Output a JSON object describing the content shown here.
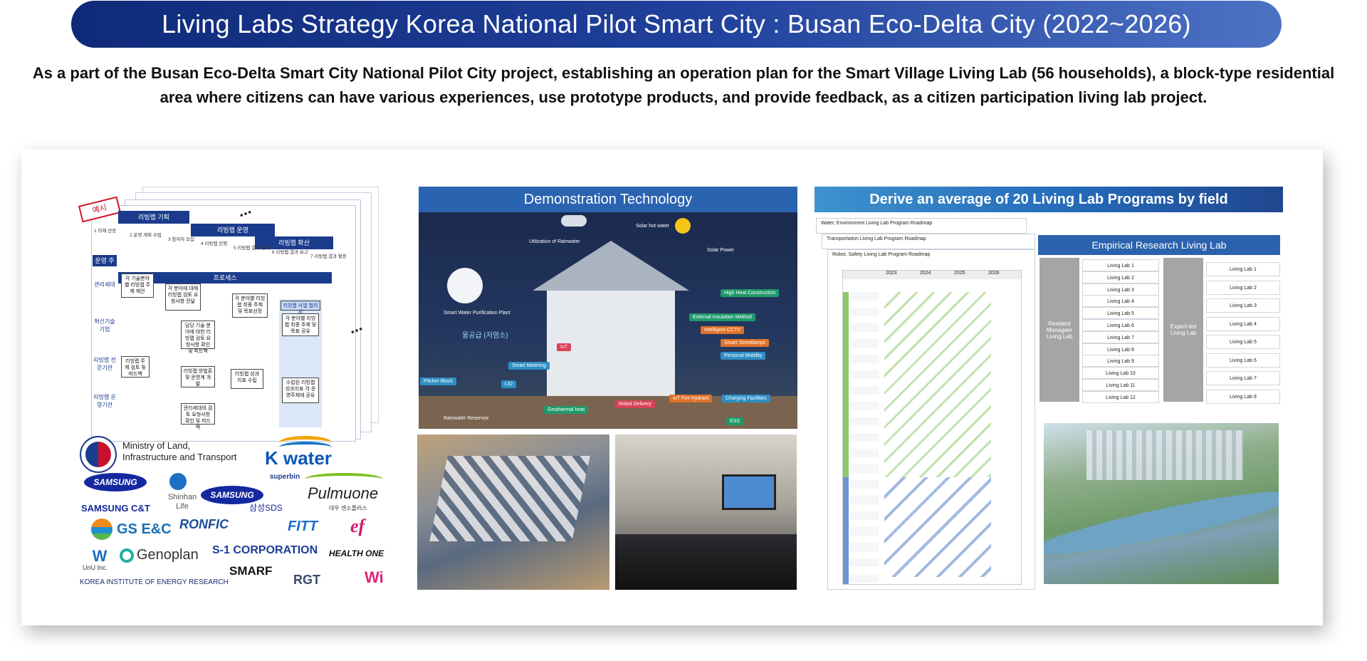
{
  "header": {
    "title": "Living Labs Strategy  Korea National Pilot Smart City : Busan Eco-Delta City (2022~2026)",
    "description": "As a part of the Busan Eco-Delta Smart City National Pilot City project, establishing an operation plan for the Smart Village Living Lab (56 households), a block-type residential area where citizens can have various experiences, use prototype products, and provide feedback, as a citizen participation living lab project."
  },
  "process_diagram": {
    "tag": "예시",
    "phases": [
      "리빙랩 기획",
      "리빙랩 운영",
      "리빙랩 확산"
    ],
    "steps": [
      "1 의제 선정",
      "2 운영 계획 수립",
      "3 참여자 모집",
      "4 리빙랩 진행",
      "5 리빙랩 결과 평가",
      "6 리빙랩 결과 보고",
      "7 리빙랩 결과 활용"
    ],
    "subhead_left": "운영 주체",
    "subhead_main": "프로세스",
    "rows": [
      "관리세대",
      "혁신기술 기업",
      "리빙랩 전문기관",
      "리빙랩 운영기관"
    ],
    "boxes": [
      "각 기술분야별 리빙랩 주제 제안",
      "각 분야에 대해 리빙랩 검토 요청사항 전달",
      "각 분야별 리빙랩 최종 주제 및 목표선정",
      "리빙랩 사업 협의회",
      "각 분야별 리빙랩 최종 주제 및 목표 공유",
      "담당 기술 분야에 대한 리빙랩 검토 요청사항 확인 및 피드백",
      "리빙랩 주제 검토 및 피드백",
      "리빙랩 방법론 및 운영계 개발",
      "리빙랩 성과지표 수립",
      "수립된 리빙랩 성과지표 각 운영주체에 공유",
      "관리세대의 검토 요청사항 확인 및 피드백"
    ],
    "ellipsis": "..."
  },
  "logos": {
    "ministry": "Ministry of Land,\nInfrastructure and Transport",
    "kwater": "K water",
    "samsung_ct": "SAMSUNG C&T",
    "samsung": "SAMSUNG",
    "shinhan": "Shinhan Life",
    "samsung2": "SAMSUNG",
    "samsung_sds": "삼성SDS",
    "superbin": "superbin",
    "pulmuone": "Pulmuone",
    "daewoo": "대우 엔소플러스",
    "gs": "GS E&C",
    "ronfic": "RONFIC",
    "fitt": "FITT",
    "ef": "ef",
    "unu": "UnU Inc.",
    "genoplan": "Genoplan",
    "s1": "S-1 CORPORATION",
    "healthone": "HEALTH ONE",
    "kier": "KOREA INSTITUTE OF ENERGY RESEARCH",
    "smarf": "SMARF",
    "rgt": "RGT",
    "wi": "Wi"
  },
  "demonstration": {
    "title": "Demonstration Technology",
    "labels": {
      "rainwater": "Utilization of Rainwater",
      "hot_water": "Solar hot water",
      "solar_power": "Solar Power",
      "purification": "Smart Water Purification Plant",
      "heat": "High Heat Construction",
      "insulation": "External Insulation Method",
      "cctv": "Intelligent CCTV",
      "streetlamps": "Smart Streetlamps",
      "mobility": "Personal Mobility",
      "metering": "Smart Metering",
      "pitcher": "Pitcher Block",
      "lid": "LID",
      "iot": "IoT",
      "geothermal": "Geothermal heat",
      "robot": "Robot Delivery",
      "fire": "IoT Fire Hydrant",
      "charging": "Charging Facilities",
      "ess": "ESS",
      "reservoir": "Rainwater Reservoir",
      "sink": "물공급 (저염소)"
    }
  },
  "programs": {
    "title": "Derive an average of 20 Living Lab Programs by field",
    "roadmaps": [
      "Water, Environment Living Lab Program Roadmap",
      "Transportation Living Lab Program Roadmap",
      "Robot, Safety Living Lab Program Roadmap"
    ],
    "years": [
      "2023",
      "2024",
      "2025",
      "2026"
    ],
    "empirical": {
      "title": "Empirical Research Living Lab",
      "resident_label": "Resident Manageer Living Lab",
      "expert_label": "Expert-led Living Lab",
      "resident_labs": [
        "Living Lab 1",
        "Living Lab 2",
        "Living Lab 3",
        "Living Lab 4",
        "Living Lab 5",
        "Living Lab 6",
        "Living Lab 7",
        "Living Lab 8",
        "Living Lab 9",
        "Living Lab 10",
        "Living Lab 11",
        "Living Lab 12"
      ],
      "expert_labs": [
        "Living Lab 1",
        "Living Lab 2",
        "Living Lab 3",
        "Living Lab 4",
        "Living Lab 5",
        "Living Lab 6",
        "Living Lab 7",
        "Living Lab 8"
      ]
    }
  }
}
